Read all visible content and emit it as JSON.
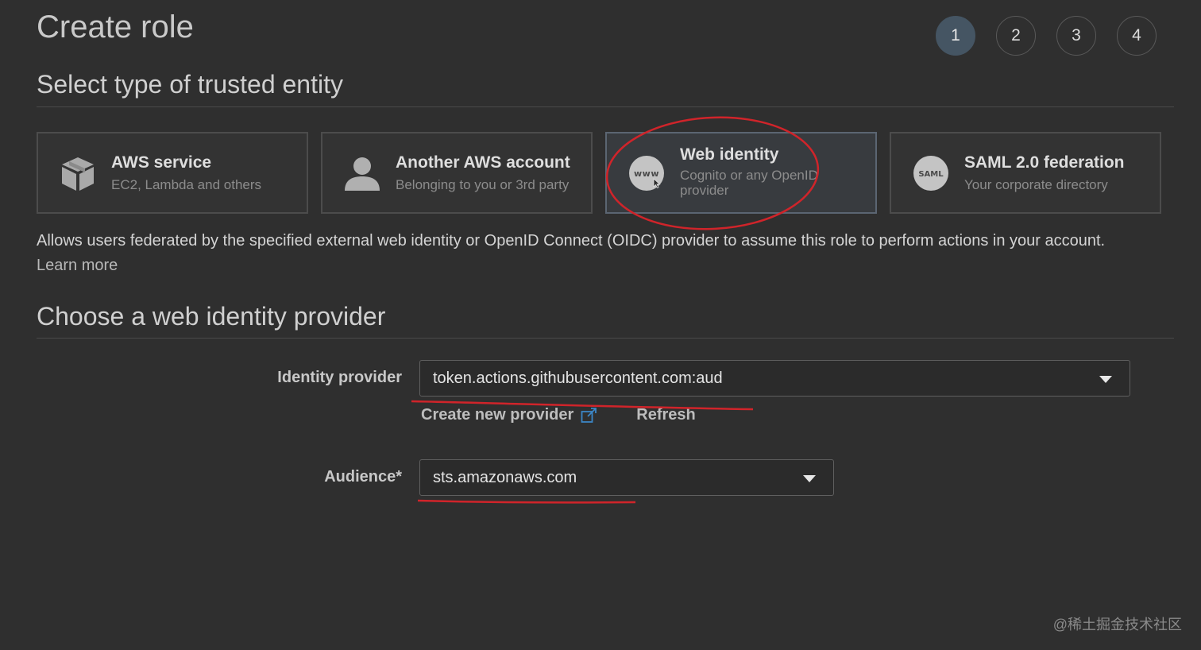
{
  "header": {
    "title": "Create role",
    "steps": [
      "1",
      "2",
      "3",
      "4"
    ],
    "active_step": "1"
  },
  "trusted_entity": {
    "heading": "Select type of trusted entity",
    "cards": [
      {
        "title": "AWS service",
        "subtitle": "EC2, Lambda and others",
        "icon": "cube-icon"
      },
      {
        "title": "Another AWS account",
        "subtitle": "Belonging to you or 3rd party",
        "icon": "user-icon"
      },
      {
        "title": "Web identity",
        "subtitle": "Cognito or any OpenID provider",
        "icon": "www-icon",
        "icon_text": "www",
        "selected": true
      },
      {
        "title": "SAML 2.0 federation",
        "subtitle": "Your corporate directory",
        "icon": "saml-icon",
        "icon_text": "SAML"
      }
    ],
    "description": "Allows users federated by the specified external web identity or OpenID Connect (OIDC) provider to assume this role to perform actions in your account.",
    "learn_more": "Learn more"
  },
  "provider": {
    "heading": "Choose a web identity provider",
    "identity_label": "Identity provider",
    "identity_value": "token.actions.githubusercontent.com:aud",
    "create_new": "Create new provider",
    "refresh": "Refresh",
    "audience_label": "Audience*",
    "audience_value": "sts.amazonaws.com"
  },
  "colors": {
    "background": "#2f2f2f",
    "annotation": "#d0242a",
    "active_step": "#455563",
    "external_link": "#3c86c6"
  },
  "watermark": "@稀土掘金技术社区"
}
